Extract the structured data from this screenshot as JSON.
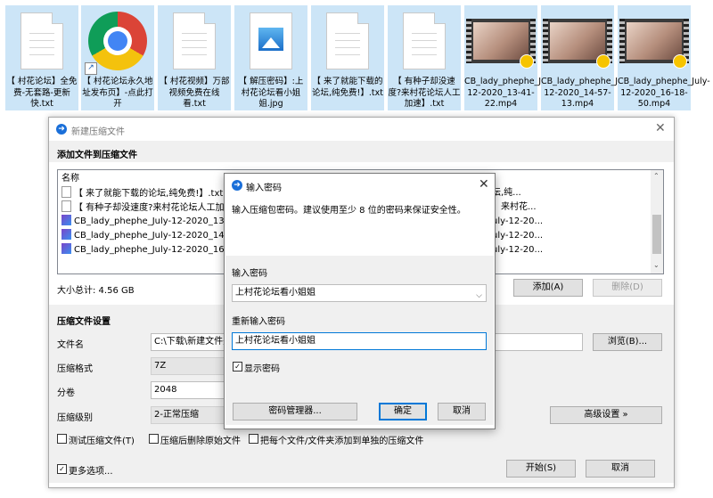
{
  "files": [
    {
      "type": "txt",
      "label": "【 村花论坛】全免费-无套路-更新快.txt"
    },
    {
      "type": "chrome",
      "label": "【 村花论坛永久地址发布页】-点此打开"
    },
    {
      "type": "txt",
      "label": "【 村花视频】万部视频免费在线看.txt"
    },
    {
      "type": "jpg",
      "label": "【 解压密码】:上村花论坛看小姐姐.jpg"
    },
    {
      "type": "txt",
      "label": "【 来了就能下载的论坛,纯免费!】.txt"
    },
    {
      "type": "txt",
      "label": "【 有种子却没速度?来村花论坛人工加速】.txt"
    },
    {
      "type": "video",
      "label": "CB_lady_phephe_July-12-2020_13-41-22.mp4",
      "badge": "Player"
    },
    {
      "type": "video",
      "label": "CB_lady_phephe_July-12-2020_14-57-13.mp4",
      "badge": "Player"
    },
    {
      "type": "video",
      "label": "CB_lady_phephe_July-12-2020_16-18-50.mp4",
      "badge": "Player"
    }
  ],
  "main_dialog": {
    "title": "新建压缩文件",
    "section_add": "添加文件到压缩文件",
    "list_header": "名称",
    "list_rows": [
      {
        "icon": "txt",
        "name": "【 来了就能下载的论坛,纯免费!】.txt",
        "tail": "坛,纯..."
      },
      {
        "icon": "txt",
        "name": "【 有种子却没速度?来村花论坛人工加速",
        "tail": "』来村花..."
      },
      {
        "icon": "video",
        "name": "CB_lady_phephe_July-12-2020_13-41-",
        "tail": "uly-12-20..."
      },
      {
        "icon": "video",
        "name": "CB_lady_phephe_July-12-2020_14-57-",
        "tail": "uly-12-20..."
      },
      {
        "icon": "video",
        "name": "CB_lady_phephe_July-12-2020_16-18-",
        "tail": "uly-12-20..."
      }
    ],
    "total_size": "大小总计: 4.56 GB",
    "add_button": "添加(A)",
    "delete_button": "删除(D)",
    "section_settings": "压缩文件设置",
    "filename_label": "文件名",
    "filename_value": "C:\\下载\\新建文件夹",
    "browse_button": "浏览(B)...",
    "format_label": "压缩格式",
    "format_value": "7Z",
    "volume_label": "分卷",
    "volume_value": "2048",
    "level_label": "压缩级别",
    "level_value": "2-正常压缩",
    "advanced_button": "高级设置 »",
    "check_test": "测试压缩文件(T)",
    "check_delete": "压缩后删除原始文件",
    "check_each": "把每个文件/文件夹添加到单独的压缩文件",
    "more_options": "更多选项...",
    "start_button": "开始(S)",
    "cancel_button": "取消"
  },
  "password_dialog": {
    "title": "输入密码",
    "description": "输入压缩包密码。建议使用至少 8 位的密码来保证安全性。",
    "enter_label": "输入密码",
    "enter_value": "上村花论坛看小姐姐",
    "reenter_label": "重新输入密码",
    "reenter_value": "上村花论坛看小姐姐",
    "show_password": "显示密码",
    "manager_button": "密码管理器...",
    "ok_button": "确定",
    "cancel_button": "取消"
  }
}
